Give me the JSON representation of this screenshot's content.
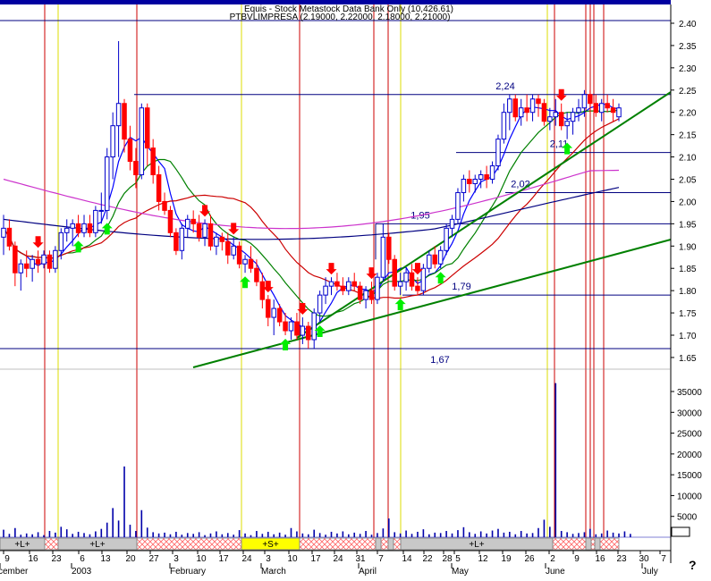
{
  "header": {
    "line1": "Equis - Stock Metastock Data Bank Only (10,426.61)",
    "line2": "PTBVLIMPRESA (2.19000, 2.22000, 2.18000, 2.21000)"
  },
  "colors": {
    "up": "#0000cc",
    "down": "#ff0000",
    "axis": "#000000",
    "vline": "#cc0000",
    "vline_alt": "#dddd00",
    "ma_short": "#0000ff",
    "ma_mid": "#008000",
    "ma_long": "#cc0000",
    "ma_200": "#cc33cc",
    "ma_100": "#000080",
    "trend": "#008000",
    "hline": "#000080",
    "band_label": "#000000",
    "arrow_up": "#00ee00",
    "arrow_down": "#ff0000",
    "band_long": "#c8c8c8",
    "band_short": "#ffff00",
    "band_hatch": "#ff6666"
  },
  "chart_data": {
    "type": "candlestick",
    "title": "PTBVLIMPRESA (2.19000, 2.22000, 2.18000, 2.21000)",
    "y_price_ticks": [
      "2.40",
      "2.35",
      "2.30",
      "2.25",
      "2.20",
      "2.15",
      "2.10",
      "2.05",
      "2.00",
      "1.95",
      "1.90",
      "1.85",
      "1.80",
      "1.75",
      "1.70",
      "1.65"
    ],
    "ylim_price": [
      1.63,
      2.44
    ],
    "y_volume_ticks": [
      "35000",
      "30000",
      "25000",
      "20000",
      "15000",
      "10000",
      "5000"
    ],
    "ylim_volume": [
      0,
      40000
    ],
    "x_tick_labels": [
      "9",
      "16",
      "23",
      "6",
      "13",
      "20",
      "27",
      "3",
      "10",
      "17",
      "24",
      "3",
      "10",
      "17",
      "24",
      "31",
      "7",
      "14",
      "22",
      "28",
      "5",
      "12",
      "19",
      "26",
      "2",
      "9",
      "16",
      "23",
      "30",
      "7"
    ],
    "x_month_labels": [
      "cember",
      "2003",
      "February",
      "March",
      "April",
      "May",
      "June",
      "July"
    ],
    "horizontal_levels": [
      {
        "label": "2,24",
        "value": 2.24
      },
      {
        "label": "2,11",
        "value": 2.11
      },
      {
        "label": "2,02",
        "value": 2.02
      },
      {
        "label": "1,95",
        "value": 1.95
      },
      {
        "label": "1,79",
        "value": 1.79
      },
      {
        "label": "1,67",
        "value": 1.67
      }
    ],
    "signal_bands": [
      {
        "label": "+L+",
        "kind": "long"
      },
      {
        "label": "+L+",
        "kind": "long"
      },
      {
        "label": "+S+",
        "kind": "short"
      },
      {
        "label": "+L+",
        "kind": "long"
      }
    ],
    "candles": [
      [
        1.92,
        1.97,
        1.88,
        1.94
      ],
      [
        1.94,
        1.96,
        1.89,
        1.9
      ],
      [
        1.9,
        1.91,
        1.81,
        1.84
      ],
      [
        1.84,
        1.87,
        1.8,
        1.86
      ],
      [
        1.86,
        1.89,
        1.83,
        1.85
      ],
      [
        1.85,
        1.88,
        1.82,
        1.87
      ],
      [
        1.87,
        1.89,
        1.84,
        1.86
      ],
      [
        1.86,
        1.89,
        1.85,
        1.88
      ],
      [
        1.88,
        1.89,
        1.84,
        1.85
      ],
      [
        1.85,
        1.9,
        1.84,
        1.89
      ],
      [
        1.89,
        1.94,
        1.87,
        1.93
      ],
      [
        1.93,
        1.96,
        1.91,
        1.94
      ],
      [
        1.94,
        1.96,
        1.9,
        1.95
      ],
      [
        1.95,
        1.97,
        1.92,
        1.93
      ],
      [
        1.93,
        1.97,
        1.92,
        1.95
      ],
      [
        1.95,
        1.97,
        1.92,
        1.93
      ],
      [
        1.93,
        1.99,
        1.92,
        1.98
      ],
      [
        1.98,
        2.02,
        1.95,
        1.98
      ],
      [
        1.98,
        2.12,
        1.96,
        2.1
      ],
      [
        2.1,
        2.2,
        2.05,
        2.17
      ],
      [
        2.17,
        2.36,
        2.1,
        2.22
      ],
      [
        2.22,
        2.23,
        2.11,
        2.14
      ],
      [
        2.14,
        2.17,
        2.07,
        2.09
      ],
      [
        2.09,
        2.12,
        2.03,
        2.06
      ],
      [
        2.06,
        2.22,
        2.05,
        2.21
      ],
      [
        2.21,
        2.22,
        2.08,
        2.12
      ],
      [
        2.12,
        2.14,
        2.04,
        2.06
      ],
      [
        2.06,
        2.08,
        1.98,
        2.0
      ],
      [
        2.0,
        2.02,
        1.97,
        1.98
      ],
      [
        1.98,
        1.99,
        1.92,
        1.93
      ],
      [
        1.93,
        1.94,
        1.88,
        1.89
      ],
      [
        1.89,
        1.95,
        1.87,
        1.94
      ],
      [
        1.94,
        1.97,
        1.92,
        1.96
      ],
      [
        1.96,
        1.98,
        1.93,
        1.95
      ],
      [
        1.95,
        1.97,
        1.91,
        1.92
      ],
      [
        1.92,
        1.96,
        1.9,
        1.95
      ],
      [
        1.95,
        1.97,
        1.89,
        1.9
      ],
      [
        1.9,
        1.93,
        1.88,
        1.92
      ],
      [
        1.92,
        1.93,
        1.89,
        1.91
      ],
      [
        1.91,
        1.93,
        1.86,
        1.88
      ],
      [
        1.88,
        1.92,
        1.87,
        1.9
      ],
      [
        1.9,
        1.91,
        1.85,
        1.86
      ],
      [
        1.86,
        1.88,
        1.84,
        1.87
      ],
      [
        1.87,
        1.9,
        1.84,
        1.85
      ],
      [
        1.85,
        1.87,
        1.81,
        1.82
      ],
      [
        1.82,
        1.84,
        1.76,
        1.78
      ],
      [
        1.78,
        1.79,
        1.72,
        1.74
      ],
      [
        1.74,
        1.78,
        1.7,
        1.76
      ],
      [
        1.76,
        1.77,
        1.72,
        1.73
      ],
      [
        1.73,
        1.75,
        1.7,
        1.71
      ],
      [
        1.71,
        1.74,
        1.69,
        1.73
      ],
      [
        1.73,
        1.75,
        1.69,
        1.7
      ],
      [
        1.7,
        1.74,
        1.68,
        1.72
      ],
      [
        1.72,
        1.73,
        1.67,
        1.69
      ],
      [
        1.69,
        1.76,
        1.67,
        1.75
      ],
      [
        1.75,
        1.8,
        1.73,
        1.79
      ],
      [
        1.79,
        1.83,
        1.77,
        1.81
      ],
      [
        1.81,
        1.83,
        1.79,
        1.82
      ],
      [
        1.82,
        1.84,
        1.8,
        1.81
      ],
      [
        1.81,
        1.83,
        1.79,
        1.8
      ],
      [
        1.8,
        1.83,
        1.79,
        1.82
      ],
      [
        1.82,
        1.84,
        1.8,
        1.81
      ],
      [
        1.81,
        1.82,
        1.77,
        1.78
      ],
      [
        1.78,
        1.81,
        1.76,
        1.8
      ],
      [
        1.8,
        1.82,
        1.77,
        1.78
      ],
      [
        1.78,
        1.84,
        1.77,
        1.83
      ],
      [
        1.83,
        1.95,
        1.82,
        1.92
      ],
      [
        1.92,
        1.93,
        1.86,
        1.87
      ],
      [
        1.87,
        1.88,
        1.8,
        1.81
      ],
      [
        1.81,
        1.84,
        1.79,
        1.82
      ],
      [
        1.82,
        1.85,
        1.8,
        1.84
      ],
      [
        1.84,
        1.86,
        1.8,
        1.81
      ],
      [
        1.81,
        1.83,
        1.79,
        1.8
      ],
      [
        1.8,
        1.86,
        1.79,
        1.85
      ],
      [
        1.85,
        1.89,
        1.84,
        1.88
      ],
      [
        1.88,
        1.9,
        1.85,
        1.86
      ],
      [
        1.86,
        1.9,
        1.85,
        1.89
      ],
      [
        1.89,
        1.95,
        1.88,
        1.94
      ],
      [
        1.94,
        1.97,
        1.92,
        1.96
      ],
      [
        1.96,
        2.03,
        1.95,
        2.02
      ],
      [
        2.02,
        2.06,
        2.0,
        2.05
      ],
      [
        2.05,
        2.07,
        2.02,
        2.04
      ],
      [
        2.04,
        2.06,
        2.02,
        2.05
      ],
      [
        2.05,
        2.07,
        2.03,
        2.06
      ],
      [
        2.06,
        2.08,
        2.03,
        2.05
      ],
      [
        2.05,
        2.09,
        2.04,
        2.08
      ],
      [
        2.08,
        2.15,
        2.07,
        2.14
      ],
      [
        2.14,
        2.22,
        2.13,
        2.2
      ],
      [
        2.2,
        2.24,
        2.16,
        2.23
      ],
      [
        2.23,
        2.24,
        2.18,
        2.19
      ],
      [
        2.19,
        2.23,
        2.17,
        2.21
      ],
      [
        2.21,
        2.24,
        2.18,
        2.2
      ],
      [
        2.2,
        2.24,
        2.18,
        2.23
      ],
      [
        2.23,
        2.24,
        2.19,
        2.22
      ],
      [
        2.22,
        2.23,
        2.17,
        2.18
      ],
      [
        2.18,
        2.21,
        2.16,
        2.19
      ],
      [
        2.19,
        2.23,
        2.17,
        2.2
      ],
      [
        2.2,
        2.22,
        2.16,
        2.17
      ],
      [
        2.17,
        2.2,
        2.14,
        2.18
      ],
      [
        2.18,
        2.21,
        2.15,
        2.2
      ],
      [
        2.2,
        2.23,
        2.18,
        2.21
      ],
      [
        2.21,
        2.25,
        2.19,
        2.24
      ],
      [
        2.24,
        2.25,
        2.2,
        2.22
      ],
      [
        2.22,
        2.24,
        2.19,
        2.2
      ],
      [
        2.2,
        2.23,
        2.18,
        2.22
      ],
      [
        2.22,
        2.24,
        2.2,
        2.21
      ],
      [
        2.21,
        2.23,
        2.18,
        2.2
      ],
      [
        2.19,
        2.22,
        2.18,
        2.21
      ]
    ],
    "volume": [
      1800,
      800,
      2200,
      600,
      900,
      700,
      1200,
      500,
      1500,
      1100,
      2500,
      1900,
      800,
      1300,
      1000,
      700,
      1400,
      2000,
      3500,
      7000,
      4000,
      17000,
      3000,
      1500,
      6500,
      2300,
      1200,
      900,
      1100,
      700,
      1300,
      600,
      1000,
      800,
      1200,
      500,
      900,
      1400,
      700,
      1000,
      600,
      1700,
      900,
      500,
      1500,
      800,
      1300,
      700,
      1100,
      600,
      2200,
      1400,
      900,
      700,
      1800,
      1000,
      600,
      1300,
      900,
      1400,
      700,
      1100,
      800,
      1500,
      600,
      1000,
      2100,
      4500,
      1200,
      900,
      1600,
      800,
      1300,
      1900,
      700,
      1100,
      1000,
      1500,
      900,
      1700,
      2400,
      1200,
      800,
      1400,
      900,
      1600,
      2000,
      1100,
      1300,
      700,
      1500,
      900,
      1000,
      2200,
      4200,
      2500,
      37000,
      1500,
      1200,
      800,
      1000,
      1200,
      2000,
      700,
      900,
      1600,
      1100,
      900,
      1400,
      800
    ]
  },
  "footer": {
    "corner_mark": "?"
  }
}
